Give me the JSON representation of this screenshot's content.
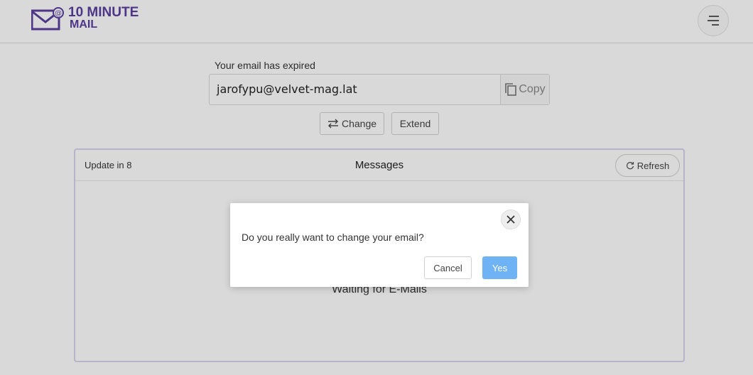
{
  "brand": {
    "line1": "10 MINUTE",
    "line2": "MAIL",
    "color": "#5b3fa0"
  },
  "email": {
    "status_label": "Your email has expired",
    "address": "jarofypu@velvet-mag.lat",
    "copy_label": "Copy",
    "change_label": "Change",
    "extend_label": "Extend"
  },
  "inbox": {
    "update_label": "Update in 8",
    "title": "Messages",
    "refresh_label": "Refresh",
    "empty_text": "Waiting for E-Mails"
  },
  "dialog": {
    "message": "Do you really want to change your email?",
    "cancel_label": "Cancel",
    "confirm_label": "Yes",
    "confirm_color": "#6fb3f5"
  },
  "icons": [
    "mail-logo-icon",
    "menu-icon",
    "copy-icon",
    "swap-icon",
    "refresh-icon",
    "close-icon"
  ]
}
